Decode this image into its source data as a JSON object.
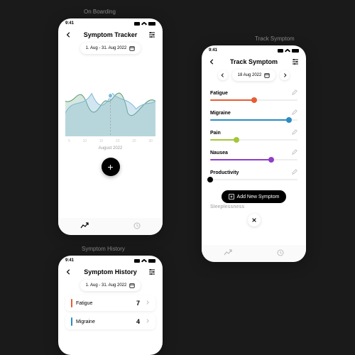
{
  "labels": {
    "onboarding": "On Boarding",
    "track": "Track Symptom",
    "history": "Symptom History"
  },
  "status": {
    "time": "9:41"
  },
  "onboarding": {
    "title": "Symptom Tracker",
    "date_range": "1. Aug - 31. Aug 2022",
    "axis_month": "August 2022",
    "fab": "+"
  },
  "chart_data": {
    "type": "area",
    "title": "Symptom Tracker – August 2022",
    "xlabel": "August 2022",
    "xlim": [
      1,
      31
    ],
    "ylim": [
      0,
      10
    ],
    "x_ticks": [
      5,
      10,
      15,
      20,
      25,
      30
    ],
    "highlight_x": 17,
    "series": [
      {
        "name": "series-green",
        "color": "#5a9e7a",
        "x": [
          1,
          5,
          9,
          13,
          17,
          21,
          25,
          29,
          31
        ],
        "values": [
          5,
          4,
          7,
          3,
          5,
          4,
          8,
          3,
          5
        ]
      },
      {
        "name": "series-blue",
        "color": "#7fb8d8",
        "x": [
          1,
          5,
          9,
          13,
          17,
          21,
          25,
          29,
          31
        ],
        "values": [
          3,
          5,
          4,
          6,
          4,
          6,
          5,
          4,
          5
        ]
      }
    ]
  },
  "track": {
    "title": "Track Symptom",
    "date": "18 Aug 2022",
    "symptoms": [
      {
        "name": "Fatigue",
        "value": 5,
        "max": 10,
        "color": "#e85c33"
      },
      {
        "name": "Migraine",
        "value": 9,
        "max": 10,
        "color": "#2a8cc4"
      },
      {
        "name": "Pain",
        "value": 3,
        "max": 10,
        "color": "#a4c639"
      },
      {
        "name": "Nausea",
        "value": 7,
        "max": 10,
        "color": "#8e3fc7"
      },
      {
        "name": "Productivity",
        "value": 0,
        "max": 10,
        "color": "#000000"
      }
    ],
    "faded": "Sleeplessness",
    "add_label": "Add New Symptom"
  },
  "history": {
    "title": "Symptom History",
    "date_range": "1. Aug - 31. Aug 2022",
    "rows": [
      {
        "name": "Fatigue",
        "value": 7,
        "color": "#e85c33"
      },
      {
        "name": "Migraine",
        "value": 4,
        "color": "#2a8cc4"
      }
    ]
  }
}
